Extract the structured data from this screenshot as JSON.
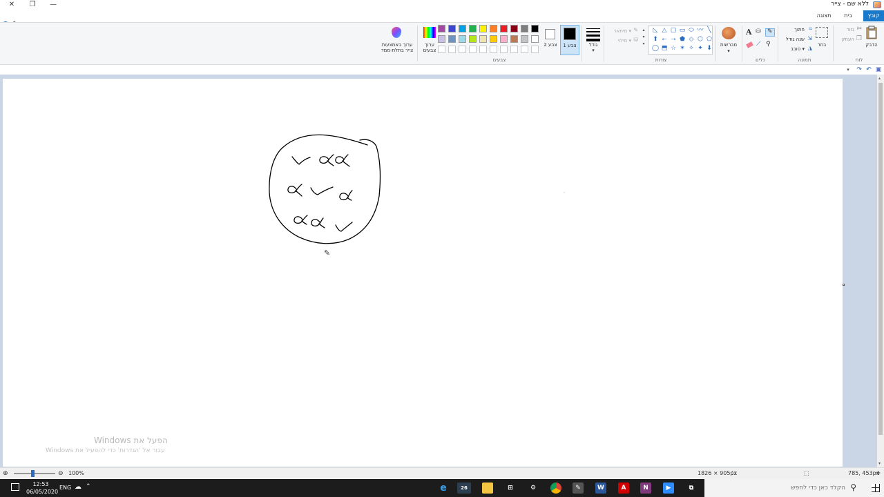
{
  "window": {
    "title": "ללא שם - צייר",
    "close_glyph": "✕",
    "max_glyph": "❐",
    "min_glyph": "—"
  },
  "tabs": {
    "file": "קובץ",
    "home": "בית",
    "view": "תצוגה"
  },
  "ribbon": {
    "clipboard": {
      "label": "לוח",
      "paste": "הדבק",
      "cut": "גזור",
      "copy": "העתק"
    },
    "image": {
      "label": "תמונה",
      "select": "בחר",
      "crop": "חתוך",
      "resize": "שנה גודל",
      "rotate": "סובב ▾"
    },
    "tools": {
      "label": "כלים"
    },
    "brushes": {
      "label": "מברשות"
    },
    "shapes": {
      "label": "צורות",
      "outline": "מיתאר ▾",
      "fill": "מילוי ▾"
    },
    "size": {
      "label": "גודל"
    },
    "color1": {
      "label": "צבע 1",
      "value": "#000000"
    },
    "color2": {
      "label": "צבע 2",
      "value": "#ffffff"
    },
    "colors": {
      "label": "צבעים"
    },
    "edit_colors": {
      "label": "ערוך צבעים"
    },
    "paint3d": {
      "label": "ערוך באמצעות צייר בתלת-ממד"
    }
  },
  "palette_row1": [
    "#000000",
    "#7f7f7f",
    "#880015",
    "#ed1c24",
    "#ff7f27",
    "#fff200",
    "#22b14c",
    "#00a2e8",
    "#3f48cc",
    "#a349a4"
  ],
  "palette_row2": [
    "#ffffff",
    "#c3c3c3",
    "#b97a57",
    "#ffaec9",
    "#ffc90e",
    "#efe4b0",
    "#b5e61d",
    "#99d9ea",
    "#7092be",
    "#c8bfe7"
  ],
  "palette_row3": [
    "#ffffff",
    "#ffffff",
    "#ffffff",
    "#ffffff",
    "#ffffff",
    "#ffffff",
    "#ffffff",
    "#ffffff",
    "#ffffff",
    "#ffffff"
  ],
  "shapes_glyphs": [
    "╲",
    "〰",
    "⬭",
    "▭",
    "▢",
    "△",
    "◺",
    "⬠",
    "⬡",
    "◇",
    "⬟",
    "⭢",
    "⭠",
    "⬆",
    "⬇",
    "✦",
    "✧",
    "✶",
    "☆",
    "⬒",
    "◯",
    "◻",
    "▱",
    "⋯"
  ],
  "watermark": {
    "line1": "הפעל את Windows",
    "line2": "עבור אל 'הגדרות' כדי להפעיל את Windows"
  },
  "status": {
    "zoom": "100%",
    "canvas_size": "1826 × 905px",
    "cursor_pos": "785, 453px"
  },
  "taskbar": {
    "search_placeholder": "הקלד כאן כדי לחפש",
    "time": "12:53",
    "date": "06/05/2020",
    "lang": "ENG",
    "edge_badge": "26"
  }
}
